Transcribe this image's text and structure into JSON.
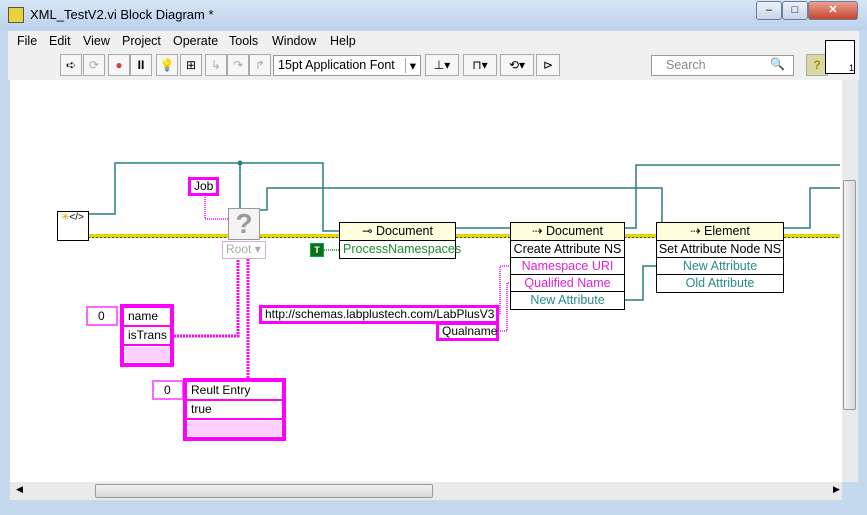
{
  "window": {
    "title": "XML_TestV2.vi Block Diagram *"
  },
  "menu": [
    "File",
    "Edit",
    "View",
    "Project",
    "Operate",
    "Tools",
    "Window",
    "Help"
  ],
  "toolbar": {
    "font": "15pt Application Font",
    "search_placeholder": "Search",
    "help": "?",
    "vi_icon_label": "1"
  },
  "diagram": {
    "job_constant": "Job",
    "unknown_node": "?",
    "root_dropdown": "Root",
    "true_constant": "T",
    "node1": {
      "class": "Document",
      "rows": [
        "ProcessNamespaces"
      ]
    },
    "node2": {
      "class": "Document",
      "method": "Create Attribute NS",
      "rows": [
        "Namespace URI",
        "Qualified Name",
        "New Attribute"
      ]
    },
    "node3": {
      "class": "Element",
      "method": "Set Attribute Node NS",
      "rows": [
        "New Attribute",
        "Old Attribute"
      ]
    },
    "array1": {
      "index": "0",
      "items": [
        "name",
        "isTrans",
        ""
      ]
    },
    "array2": {
      "index": "0",
      "items": [
        "Reult Entry",
        "true",
        ""
      ]
    },
    "url_constant": "http://schemas.labplustech.com/LabPlusV3",
    "qualname_constant": "Qualname"
  },
  "colors": {
    "reference_wire": "#2a7f7f",
    "string_wire": "#ff00ff",
    "xml_wire": "#d8d000",
    "boolean": "#007a00"
  }
}
